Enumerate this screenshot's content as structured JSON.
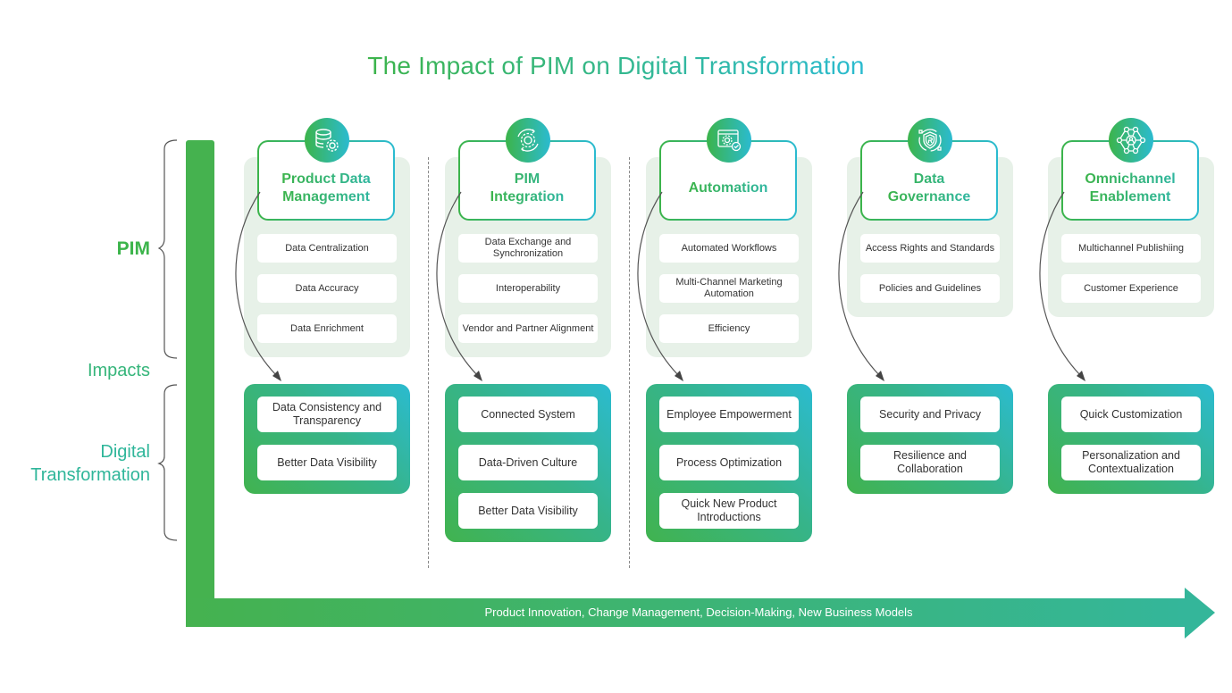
{
  "title": "The Impact of PIM on Digital Transformation",
  "side_labels": {
    "pim": "PIM",
    "impacts": "Impacts",
    "digital_transformation_line1": "Digital",
    "digital_transformation_line2": "Transformation"
  },
  "bottom_arrow": {
    "text": "Product Innovation, Change Management, Decision-Making, New Business Models"
  },
  "colors": {
    "green": "#3cb44b",
    "teal": "#2bbbd0",
    "column_bg": "#e7f1e8"
  },
  "columns": [
    {
      "icon": "database-gear-icon",
      "title_line1": "Product Data",
      "title_line2": "Management",
      "pim_items": [
        "Data Centralization",
        "Data Accuracy",
        "Data Enrichment"
      ],
      "impact_items": [
        "Data Consistency and Transparency",
        "Better Data Visibility"
      ]
    },
    {
      "icon": "gear-sync-icon",
      "title_line1": "PIM",
      "title_line2": "Integration",
      "pim_items": [
        "Data Exchange and Synchronization",
        "Interoperability",
        "Vendor and Partner Alignment"
      ],
      "impact_items": [
        "Connected System",
        "Data-Driven Culture",
        "Better Data Visibility"
      ]
    },
    {
      "icon": "automation-window-icon",
      "title_line1": "Automation",
      "title_line2": "",
      "pim_items": [
        "Automated Workflows",
        "Multi-Channel Marketing Automation",
        "Efficiency"
      ],
      "impact_items": [
        "Employee Empowerment",
        "Process Optimization",
        "Quick New Product Introductions"
      ]
    },
    {
      "icon": "shield-icon",
      "title_line1": "Data",
      "title_line2": "Governance",
      "pim_items": [
        "Access Rights and Standards",
        "Policies and Guidelines"
      ],
      "impact_items": [
        "Security and Privacy",
        "Resilience and Collaboration"
      ]
    },
    {
      "icon": "network-people-icon",
      "title_line1": "Omnichannel",
      "title_line2": "Enablement",
      "pim_items": [
        "Multichannel Publishiing",
        "Customer Experience"
      ],
      "impact_items": [
        "Quick Customization",
        "Personalization and Contextualization"
      ]
    }
  ]
}
